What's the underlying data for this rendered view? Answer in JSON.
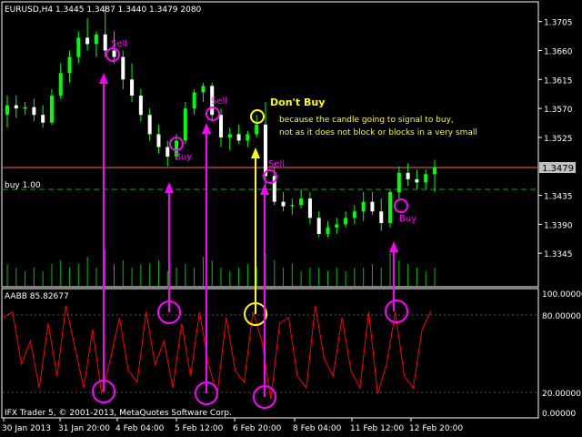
{
  "header": {
    "symbol_line": "EURUSD,H4  1.3445 1.3487 1.3440 1.3479  2080",
    "position_line": "buy 1.00"
  },
  "indicator": {
    "name": "AABB 85.82677",
    "levels": [
      "100.00000",
      "80.00000",
      "20.00000",
      "0.00000"
    ]
  },
  "footer": {
    "copyright": "IFX Trader 5, © 2001-2013, MetaQuotes Software Corp."
  },
  "axis": {
    "price_ticks": [
      "1.3705",
      "1.3660",
      "1.3615",
      "1.3570",
      "1.3525",
      "1.3435",
      "1.3390",
      "1.3345"
    ],
    "current_price": "1.3479",
    "time_ticks": [
      "30 Jan 2013",
      "31 Jan 20:00",
      "4 Feb 04:00",
      "5 Feb 12:00",
      "6 Feb 20:00",
      "8 Feb 04:00",
      "11 Feb 12:00",
      "12 Feb 20:00"
    ]
  },
  "annotations": {
    "sell": "Sell",
    "buy": "Buy",
    "dont_buy_title": "Don't Buy",
    "dont_buy_line1": "because the candle going to signal to buy,",
    "dont_buy_line2": "not as it does not block or blocks in a very small"
  },
  "colors": {
    "background": "#000000",
    "bull_candle": "#00ff00",
    "bear_candle": "#ffffff",
    "volume": "#00c000",
    "indicator_line": "#ff0000",
    "signal_arrow": "#ff00ff",
    "warning": "#ffff00",
    "current_price_line": "#ff6060"
  },
  "chart_data": {
    "type": "candlestick",
    "ylim": [
      1.33,
      1.373
    ],
    "candles_ohlc": [
      [
        1.356,
        1.359,
        1.354,
        1.3575
      ],
      [
        1.3575,
        1.359,
        1.3555,
        1.357
      ],
      [
        1.357,
        1.358,
        1.356,
        1.3572
      ],
      [
        1.3572,
        1.3585,
        1.355,
        1.356
      ],
      [
        1.356,
        1.3575,
        1.354,
        1.3548
      ],
      [
        1.3548,
        1.36,
        1.3545,
        1.359
      ],
      [
        1.359,
        1.364,
        1.3585,
        1.3625
      ],
      [
        1.3625,
        1.366,
        1.361,
        1.365
      ],
      [
        1.365,
        1.369,
        1.364,
        1.368
      ],
      [
        1.368,
        1.371,
        1.366,
        1.367
      ],
      [
        1.367,
        1.369,
        1.365,
        1.3685
      ],
      [
        1.3685,
        1.373,
        1.365,
        1.366
      ],
      [
        1.366,
        1.369,
        1.364,
        1.365
      ],
      [
        1.365,
        1.366,
        1.36,
        1.3615
      ],
      [
        1.3615,
        1.364,
        1.358,
        1.359
      ],
      [
        1.359,
        1.36,
        1.355,
        1.356
      ],
      [
        1.356,
        1.357,
        1.352,
        1.353
      ],
      [
        1.353,
        1.3545,
        1.35,
        1.351
      ],
      [
        1.351,
        1.352,
        1.348,
        1.3495
      ],
      [
        1.3495,
        1.353,
        1.349,
        1.352
      ],
      [
        1.352,
        1.358,
        1.3515,
        1.357
      ],
      [
        1.357,
        1.36,
        1.356,
        1.3595
      ],
      [
        1.3595,
        1.361,
        1.358,
        1.3605
      ],
      [
        1.3605,
        1.361,
        1.355,
        1.356
      ],
      [
        1.356,
        1.357,
        1.351,
        1.3525
      ],
      [
        1.3525,
        1.354,
        1.3505,
        1.353
      ],
      [
        1.353,
        1.3545,
        1.3515,
        1.352
      ],
      [
        1.352,
        1.3535,
        1.351,
        1.353
      ],
      [
        1.353,
        1.356,
        1.3525,
        1.3545
      ],
      [
        1.3545,
        1.358,
        1.344,
        1.3465
      ],
      [
        1.3465,
        1.348,
        1.342,
        1.3425
      ],
      [
        1.3425,
        1.344,
        1.341,
        1.3418
      ],
      [
        1.3418,
        1.343,
        1.3405,
        1.342
      ],
      [
        1.342,
        1.3445,
        1.3415,
        1.343
      ],
      [
        1.343,
        1.344,
        1.339,
        1.34
      ],
      [
        1.34,
        1.341,
        1.337,
        1.3375
      ],
      [
        1.3375,
        1.3395,
        1.337,
        1.3385
      ],
      [
        1.3385,
        1.34,
        1.3375,
        1.339
      ],
      [
        1.339,
        1.341,
        1.3385,
        1.34
      ],
      [
        1.34,
        1.342,
        1.339,
        1.341
      ],
      [
        1.341,
        1.344,
        1.3395,
        1.3425
      ],
      [
        1.3425,
        1.344,
        1.3405,
        1.341
      ],
      [
        1.341,
        1.343,
        1.338,
        1.3392
      ],
      [
        1.3392,
        1.3445,
        1.3385,
        1.344
      ],
      [
        1.344,
        1.348,
        1.343,
        1.347
      ],
      [
        1.347,
        1.3485,
        1.345,
        1.346
      ],
      [
        1.346,
        1.3475,
        1.3445,
        1.3455
      ],
      [
        1.3455,
        1.3475,
        1.3445,
        1.3468
      ],
      [
        1.3468,
        1.349,
        1.344,
        1.3479
      ]
    ],
    "volume": [
      0.6,
      0.5,
      0.4,
      0.5,
      0.4,
      0.6,
      0.7,
      0.5,
      0.6,
      0.8,
      0.5,
      1.0,
      0.6,
      0.7,
      0.5,
      0.6,
      0.6,
      0.7,
      0.4,
      0.5,
      0.6,
      0.5,
      0.8,
      0.7,
      0.5,
      0.4,
      0.5,
      0.6,
      0.5,
      0.9,
      0.7,
      0.5,
      0.6,
      0.4,
      0.5,
      0.5,
      0.4,
      0.5,
      0.4,
      0.5,
      0.5,
      0.6,
      0.5,
      0.9,
      0.7,
      0.6,
      0.5,
      0.4,
      0.5
    ],
    "indicator_values": [
      80,
      85,
      40,
      60,
      20,
      75,
      30,
      90,
      55,
      20,
      70,
      15,
      45,
      80,
      35,
      25,
      85,
      40,
      60,
      20,
      75,
      30,
      85,
      40,
      15,
      80,
      35,
      25,
      85,
      60,
      10,
      75,
      80,
      30,
      20,
      90,
      45,
      30,
      80,
      35,
      20,
      85,
      15,
      40,
      85,
      30,
      20,
      70,
      86
    ]
  }
}
